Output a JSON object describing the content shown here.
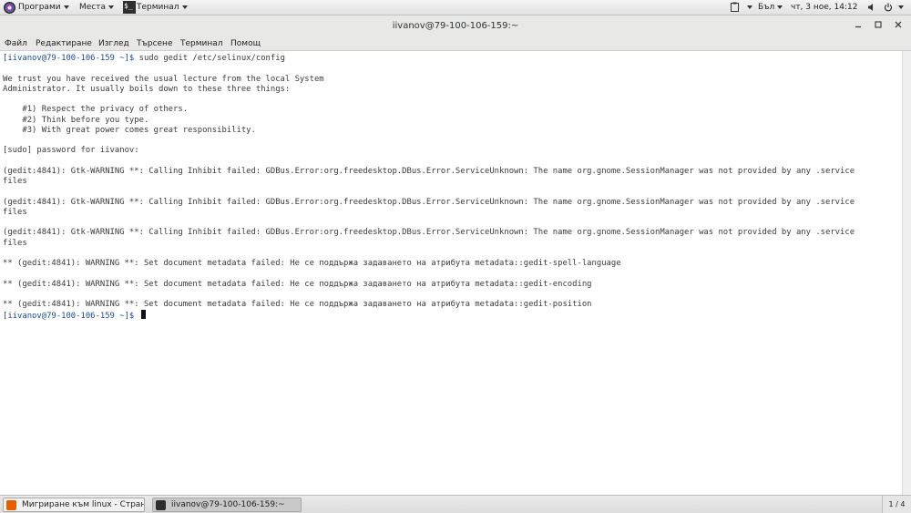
{
  "top_panel": {
    "programs_label": "Програми",
    "places_label": "Места",
    "terminal_label": "Терминал",
    "keyboard_layout": "Бъл",
    "clock": "чт, 3 ное, 14:12"
  },
  "window": {
    "title": "iivanov@79-100-106-159:~",
    "menu": [
      "Файл",
      "Редактиране",
      "Изглед",
      "Търсене",
      "Терминал",
      "Помощ"
    ]
  },
  "terminal": {
    "lines": [
      {
        "prompt": "[iivanov@79-100-106-159 ~]$",
        "text": " sudo gedit /etc/selinux/config"
      },
      {
        "text": ""
      },
      {
        "text": "We trust you have received the usual lecture from the local System"
      },
      {
        "text": "Administrator. It usually boils down to these three things:"
      },
      {
        "text": ""
      },
      {
        "text": "    #1) Respect the privacy of others."
      },
      {
        "text": "    #2) Think before you type."
      },
      {
        "text": "    #3) With great power comes great responsibility."
      },
      {
        "text": ""
      },
      {
        "text": "[sudo] password for iivanov:"
      },
      {
        "text": ""
      },
      {
        "text": "(gedit:4841): Gtk-WARNING **: Calling Inhibit failed: GDBus.Error:org.freedesktop.DBus.Error.ServiceUnknown: The name org.gnome.SessionManager was not provided by any .service"
      },
      {
        "text": "files"
      },
      {
        "text": ""
      },
      {
        "text": "(gedit:4841): Gtk-WARNING **: Calling Inhibit failed: GDBus.Error:org.freedesktop.DBus.Error.ServiceUnknown: The name org.gnome.SessionManager was not provided by any .service"
      },
      {
        "text": "files"
      },
      {
        "text": ""
      },
      {
        "text": "(gedit:4841): Gtk-WARNING **: Calling Inhibit failed: GDBus.Error:org.freedesktop.DBus.Error.ServiceUnknown: The name org.gnome.SessionManager was not provided by any .service"
      },
      {
        "text": "files"
      },
      {
        "text": ""
      },
      {
        "text": "** (gedit:4841): WARNING **: Set document metadata failed: Не се поддържа задаването на атрибута metadata::gedit-spell-language"
      },
      {
        "text": ""
      },
      {
        "text": "** (gedit:4841): WARNING **: Set document metadata failed: Не се поддържа задаването на атрибута metadata::gedit-encoding"
      },
      {
        "text": ""
      },
      {
        "text": "** (gedit:4841): WARNING **: Set document metadata failed: Не се поддържа задаването на атрибута metadata::gedit-position"
      },
      {
        "prompt": "[iivanov@79-100-106-159 ~]$",
        "text": " ",
        "cursor": true
      }
    ]
  },
  "taskbar": {
    "tasks": [
      {
        "label": "Мигриране към linux - Страни…",
        "icon": "firefox-icon",
        "color": "#e66000"
      },
      {
        "label": "iivanov@79-100-106-159:~",
        "icon": "terminal-icon",
        "color": "#2e2e2e"
      }
    ],
    "workspace": "1 / 4"
  }
}
